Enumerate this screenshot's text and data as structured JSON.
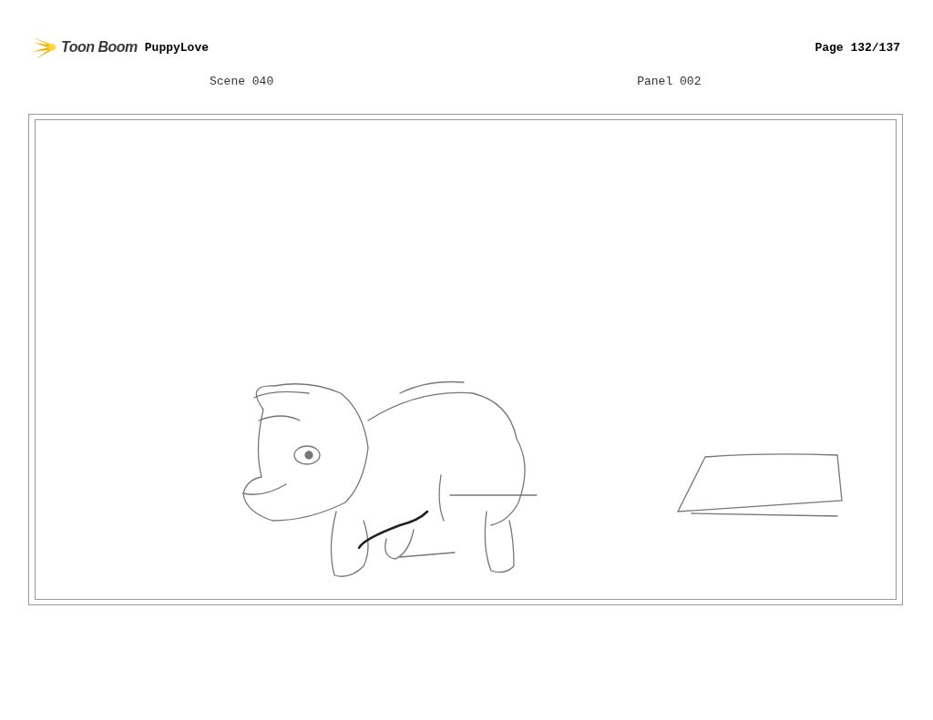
{
  "header": {
    "logo": "Toon Boom",
    "project": "PuppyLove",
    "page": "Page 132/137"
  },
  "labels": {
    "scene": "Scene 040",
    "panel": "Panel 002"
  }
}
